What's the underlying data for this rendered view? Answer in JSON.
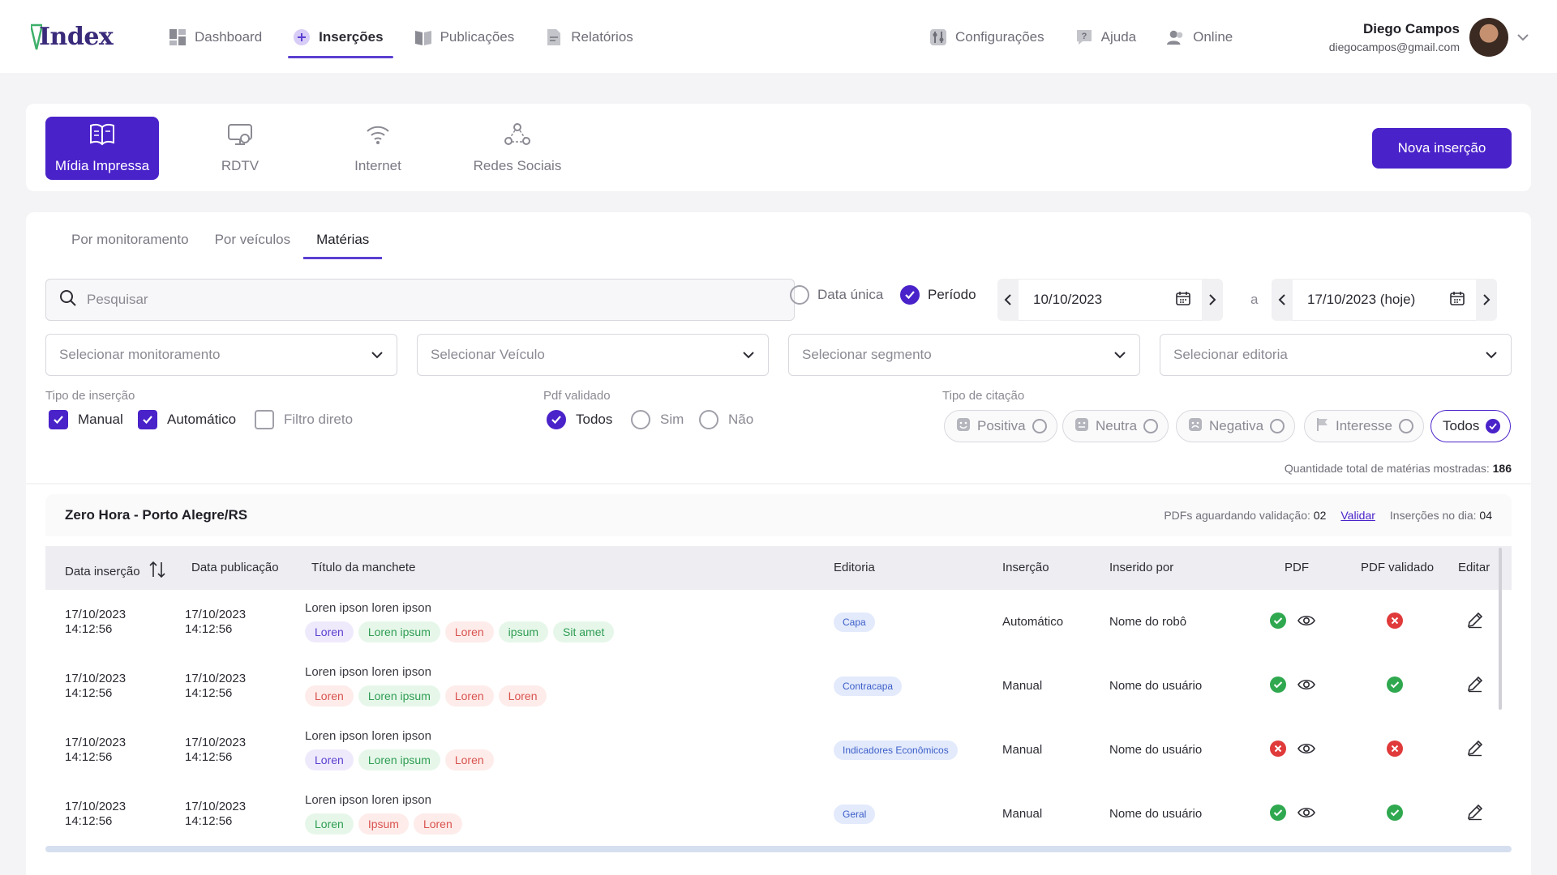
{
  "app": {
    "logo": "Index"
  },
  "nav": [
    {
      "label": "Dashboard",
      "icon": "dashboard-icon"
    },
    {
      "label": "Inserções",
      "icon": "plus-circle-icon",
      "active": true
    },
    {
      "label": "Publicações",
      "icon": "book-icon"
    },
    {
      "label": "Relatórios",
      "icon": "document-icon"
    }
  ],
  "right_nav": [
    {
      "label": "Configurações",
      "icon": "sliders-icon"
    },
    {
      "label": "Ajuda",
      "icon": "help-icon"
    },
    {
      "label": "Online",
      "icon": "users-icon"
    }
  ],
  "user": {
    "name": "Diego Campos",
    "email": "diegocampos@gmail.com"
  },
  "categories": [
    {
      "label": "Mídia Impressa",
      "icon": "book-open-icon",
      "active": true
    },
    {
      "label": "RDTV",
      "icon": "tv-icon"
    },
    {
      "label": "Internet",
      "icon": "wifi-icon"
    },
    {
      "label": "Redes Sociais",
      "icon": "network-icon"
    }
  ],
  "new_button": "Nova inserção",
  "subtabs": [
    {
      "label": "Por monitoramento"
    },
    {
      "label": "Por veículos"
    },
    {
      "label": "Matérias",
      "active": true
    }
  ],
  "search": {
    "placeholder": "Pesquisar",
    "value": ""
  },
  "date_mode": {
    "single": "Data única",
    "period": "Período",
    "selected": "Período"
  },
  "dates": {
    "from": "10/10/2023",
    "separator": "a",
    "to": "17/10/2023 (hoje)"
  },
  "selects": [
    "Selecionar monitoramento",
    "Selecionar Veículo",
    "Selecionar segmento",
    "Selecionar editoria"
  ],
  "tipo_insercao": {
    "label": "Tipo de inserção",
    "options": [
      {
        "label": "Manual",
        "checked": true
      },
      {
        "label": "Automático",
        "checked": true
      },
      {
        "label": "Filtro direto",
        "checked": false
      }
    ]
  },
  "pdf_validado": {
    "label": "Pdf validado",
    "options": [
      {
        "label": "Todos",
        "checked": true
      },
      {
        "label": "Sim",
        "checked": false
      },
      {
        "label": "Não",
        "checked": false
      }
    ]
  },
  "tipo_citacao": {
    "label": "Tipo de citação",
    "options": [
      {
        "label": "Positiva",
        "icon": "smile-icon",
        "checked": false
      },
      {
        "label": "Neutra",
        "icon": "neutral-face-icon",
        "checked": false
      },
      {
        "label": "Negativa",
        "icon": "sad-face-icon",
        "checked": false
      },
      {
        "label": "Interesse",
        "icon": "flag-icon",
        "checked": false
      },
      {
        "label": "Todos",
        "checked": true
      }
    ]
  },
  "total": {
    "label": "Quantidade total de matérias mostradas:",
    "value": "186"
  },
  "table": {
    "title": "Zero Hora - Porto Alegre/RS",
    "pdfs_label": "PDFs aguardando validação:",
    "pdfs_value": "02",
    "validate": "Validar",
    "insertions_label": "Inserções no dia:",
    "insertions_value": "04",
    "columns": [
      "Data inserção",
      "Data publicação",
      "Título da manchete",
      "Editoria",
      "Inserção",
      "Inserido por",
      "PDF",
      "PDF validado",
      "Editar"
    ],
    "rows": [
      {
        "data_insercao": [
          "17/10/2023",
          "14:12:56"
        ],
        "data_publicacao": [
          "17/10/2023",
          "14:12:56"
        ],
        "titulo": "Loren ipson loren ipson",
        "tags": [
          {
            "text": "Loren",
            "color": "purple"
          },
          {
            "text": "Loren ipsum",
            "color": "green"
          },
          {
            "text": "Loren",
            "color": "red"
          },
          {
            "text": "ipsum",
            "color": "green"
          },
          {
            "text": "Sit amet",
            "color": "green"
          }
        ],
        "editoria": "Capa",
        "insercao": "Automático",
        "inserido_por": "Nome do robô",
        "pdf": "ok",
        "pdf_validado": "error"
      },
      {
        "data_insercao": [
          "17/10/2023",
          "14:12:56"
        ],
        "data_publicacao": [
          "17/10/2023",
          "14:12:56"
        ],
        "titulo": "Loren ipson loren ipson",
        "tags": [
          {
            "text": "Loren",
            "color": "red"
          },
          {
            "text": "Loren ipsum",
            "color": "green"
          },
          {
            "text": "Loren",
            "color": "red"
          },
          {
            "text": "Loren",
            "color": "red"
          }
        ],
        "editoria": "Contracapa",
        "insercao": "Manual",
        "inserido_por": "Nome do usuário",
        "pdf": "ok",
        "pdf_validado": "ok"
      },
      {
        "data_insercao": [
          "17/10/2023",
          "14:12:56"
        ],
        "data_publicacao": [
          "17/10/2023",
          "14:12:56"
        ],
        "titulo": "Loren ipson loren ipson",
        "tags": [
          {
            "text": "Loren",
            "color": "purple"
          },
          {
            "text": "Loren ipsum",
            "color": "green"
          },
          {
            "text": "Loren",
            "color": "red"
          }
        ],
        "editoria": "Indicadores Econômicos",
        "insercao": "Manual",
        "inserido_por": "Nome do usuário",
        "pdf": "error",
        "pdf_validado": "error"
      },
      {
        "data_insercao": [
          "17/10/2023",
          "14:12:56"
        ],
        "data_publicacao": [
          "17/10/2023",
          "14:12:56"
        ],
        "titulo": "Loren ipson loren ipson",
        "tags": [
          {
            "text": "Loren",
            "color": "green"
          },
          {
            "text": "Ipsum",
            "color": "red"
          },
          {
            "text": "Loren",
            "color": "red"
          }
        ],
        "editoria": "Geral",
        "insercao": "Manual",
        "inserido_por": "Nome do usuário",
        "pdf": "ok",
        "pdf_validado": "ok"
      }
    ]
  },
  "colors": {
    "accent": "#4a22c9",
    "success": "#2fa84f",
    "danger": "#e03a3a"
  }
}
